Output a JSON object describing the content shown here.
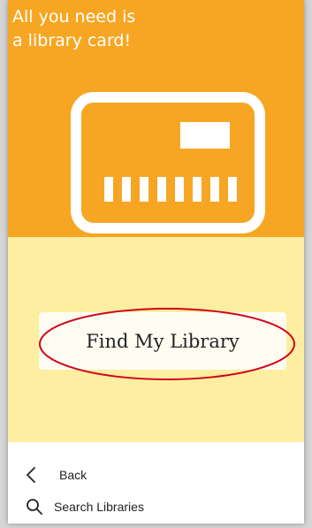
{
  "hero": {
    "title_line1": "All you need is",
    "title_line2": "a library card!",
    "background": "#f7a623",
    "icon": "library-card-icon"
  },
  "main": {
    "background": "#fdeea2",
    "find_button_label": "Find My Library",
    "annotation_color": "#d0021b"
  },
  "nav": {
    "back_label": "Back",
    "back_icon": "chevron-left-icon",
    "search_label": "Search Libraries",
    "search_icon": "search-icon"
  }
}
